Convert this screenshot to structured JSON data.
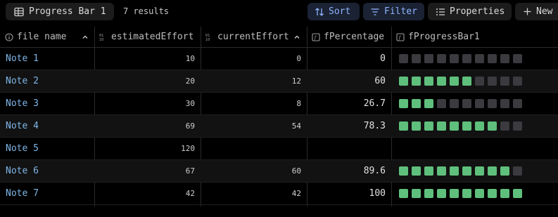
{
  "toolbar": {
    "view_name": "Progress Bar 1",
    "results": "7 results",
    "sort_label": "Sort",
    "filter_label": "Filter",
    "properties_label": "Properties",
    "new_label": "New"
  },
  "columns": [
    {
      "label": "file name",
      "icon": "info-icon"
    },
    {
      "label": "estimatedEffort",
      "icon": "number-icon"
    },
    {
      "label": "currentEffort",
      "icon": "number-icon"
    },
    {
      "label": "fPercentage",
      "icon": "formula-icon"
    },
    {
      "label": "fProgressBar1",
      "icon": "formula-icon"
    }
  ],
  "colors": {
    "accent": "#8fb4ff",
    "link": "#7fb6e8",
    "bar_filled": "#5fbf7c",
    "bar_empty": "#3a3a3f"
  },
  "rows": [
    {
      "name": "Note 1",
      "estimated": "10",
      "current": "0",
      "percentage": "0",
      "bar_filled": 0,
      "bar_total": 10
    },
    {
      "name": "Note 2",
      "estimated": "20",
      "current": "12",
      "percentage": "60",
      "bar_filled": 6,
      "bar_total": 10
    },
    {
      "name": "Note 3",
      "estimated": "30",
      "current": "8",
      "percentage": "26.7",
      "bar_filled": 3,
      "bar_total": 10
    },
    {
      "name": "Note 4",
      "estimated": "69",
      "current": "54",
      "percentage": "78.3",
      "bar_filled": 8,
      "bar_total": 10
    },
    {
      "name": "Note 5",
      "estimated": "120",
      "current": "",
      "percentage": "",
      "bar_filled": 0,
      "bar_total": 0
    },
    {
      "name": "Note 6",
      "estimated": "67",
      "current": "60",
      "percentage": "89.6",
      "bar_filled": 9,
      "bar_total": 10
    },
    {
      "name": "Note 7",
      "estimated": "42",
      "current": "42",
      "percentage": "100",
      "bar_filled": 10,
      "bar_total": 10
    }
  ]
}
